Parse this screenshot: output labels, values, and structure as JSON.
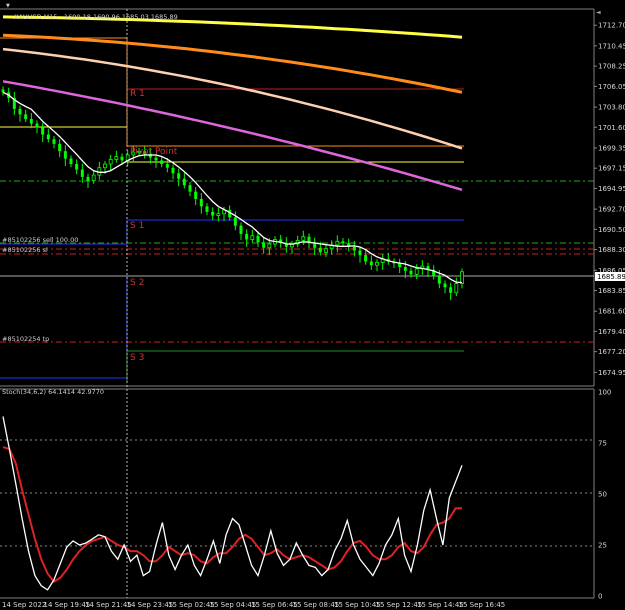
{
  "header": {
    "symbol_title": "XAUUSD,M15",
    "ohlc": "1690.18 1690.96 1685.03 1685.89"
  },
  "price_axis": {
    "labels": [
      "1712.70",
      "1710.45",
      "1708.25",
      "1706.05",
      "1703.80",
      "1701.60",
      "1699.35",
      "1697.15",
      "1694.95",
      "1692.70",
      "1690.50",
      "1688.30",
      "1686.05",
      "1683.85",
      "1681.60",
      "1679.40",
      "1677.20",
      "1674.95"
    ],
    "current_price": "1685.89"
  },
  "stoch_axis": {
    "labels": [
      "100",
      "75",
      "50",
      "25",
      "0"
    ],
    "title": "Stoch(34,6,2) 64.1414 42.9770"
  },
  "time_axis": {
    "labels": [
      "14 Sep 2022",
      "14 Sep 19:45",
      "14 Sep 21:45",
      "14 Sep 23:45",
      "15 Sep 02:45",
      "15 Sep 04:45",
      "15 Sep 06:45",
      "15 Sep 08:45",
      "15 Sep 10:45",
      "15 Sep 12:45",
      "15 Sep 14:45",
      "15 Sep 16:45"
    ]
  },
  "levels": {
    "r1": "R 1",
    "pivot": "Pivot Point",
    "s1": "S 1",
    "s2": "S 2",
    "s3": "S 3"
  },
  "orders": {
    "sell_label": "#85102256 sell 100.00",
    "sl_label": "#85102256 sl",
    "tp_label": "#85102254 tp"
  },
  "colors": {
    "background": "#000000",
    "bull_candle": "#00ff00",
    "bear_candle": "#00ff00",
    "ma_white": "#ffffff",
    "ma_orange": "#ff8c1a",
    "ma_peach": "#ffd0b0",
    "ma_violet": "#dd66dd",
    "ma_yellow": "#ffff44",
    "pivot_red": "#cc3333",
    "s_blue": "#2233ff",
    "stoch_main": "#ffffff",
    "stoch_signal": "#dd2222"
  },
  "chart_data": {
    "type": "line",
    "main_ylim": [
      1673.9,
      1713.7
    ],
    "stoch_ylim": [
      0,
      100
    ],
    "candles_close": [
      1705.4,
      1704.8,
      1703.6,
      1703.0,
      1702.5,
      1702.0,
      1701.6,
      1700.8,
      1700.3,
      1699.8,
      1699.0,
      1698.2,
      1697.6,
      1697.0,
      1696.2,
      1695.8,
      1696.4,
      1697.2,
      1697.6,
      1698.1,
      1698.4,
      1698.0,
      1698.6,
      1698.9,
      1699.0,
      1698.7,
      1698.3,
      1698.0,
      1697.6,
      1697.2,
      1696.6,
      1696.0,
      1695.3,
      1694.6,
      1693.8,
      1693.0,
      1692.4,
      1692.0,
      1692.2,
      1692.6,
      1691.8,
      1690.9,
      1690.0,
      1689.4,
      1689.8,
      1689.1,
      1688.5,
      1688.9,
      1689.4,
      1689.0,
      1688.6,
      1688.9,
      1689.3,
      1689.7,
      1689.1,
      1688.5,
      1688.0,
      1688.4,
      1688.8,
      1689.2,
      1689.0,
      1688.6,
      1688.2,
      1687.7,
      1687.0,
      1686.6,
      1686.9,
      1687.3,
      1687.0,
      1686.8,
      1686.4,
      1686.0,
      1685.6,
      1686.2,
      1686.5,
      1686.1,
      1685.4,
      1684.6,
      1684.2,
      1683.6,
      1684.6,
      1685.89
    ],
    "stoch_main": [
      88,
      72,
      55,
      38,
      22,
      10,
      5,
      3,
      8,
      16,
      24,
      27,
      25,
      26,
      28,
      30,
      29,
      22,
      18,
      25,
      17,
      20,
      10,
      12,
      25,
      36,
      20,
      13,
      20,
      25,
      15,
      10,
      18,
      27,
      16,
      30,
      38,
      35,
      25,
      15,
      10,
      20,
      32,
      21,
      15,
      18,
      26,
      20,
      15,
      14,
      10,
      13,
      22,
      28,
      37,
      25,
      18,
      14,
      10,
      16,
      25,
      30,
      38,
      20,
      12,
      25,
      42,
      52,
      38,
      25,
      48,
      56,
      64
    ],
    "stoch_signal": [
      73,
      72,
      65,
      52,
      40,
      28,
      18,
      11,
      7,
      9,
      13,
      18,
      22,
      25,
      27,
      28,
      29,
      27,
      25,
      24,
      22,
      22,
      20,
      17,
      17,
      20,
      24,
      22,
      20,
      21,
      20,
      17,
      16,
      19,
      21,
      21,
      24,
      28,
      30,
      28,
      24,
      20,
      21,
      23,
      20,
      18,
      19,
      20,
      19,
      17,
      15,
      13,
      14,
      17,
      22,
      26,
      27,
      24,
      20,
      18,
      18,
      20,
      24,
      26,
      22,
      21,
      24,
      30,
      35,
      36,
      38,
      43,
      43
    ]
  }
}
